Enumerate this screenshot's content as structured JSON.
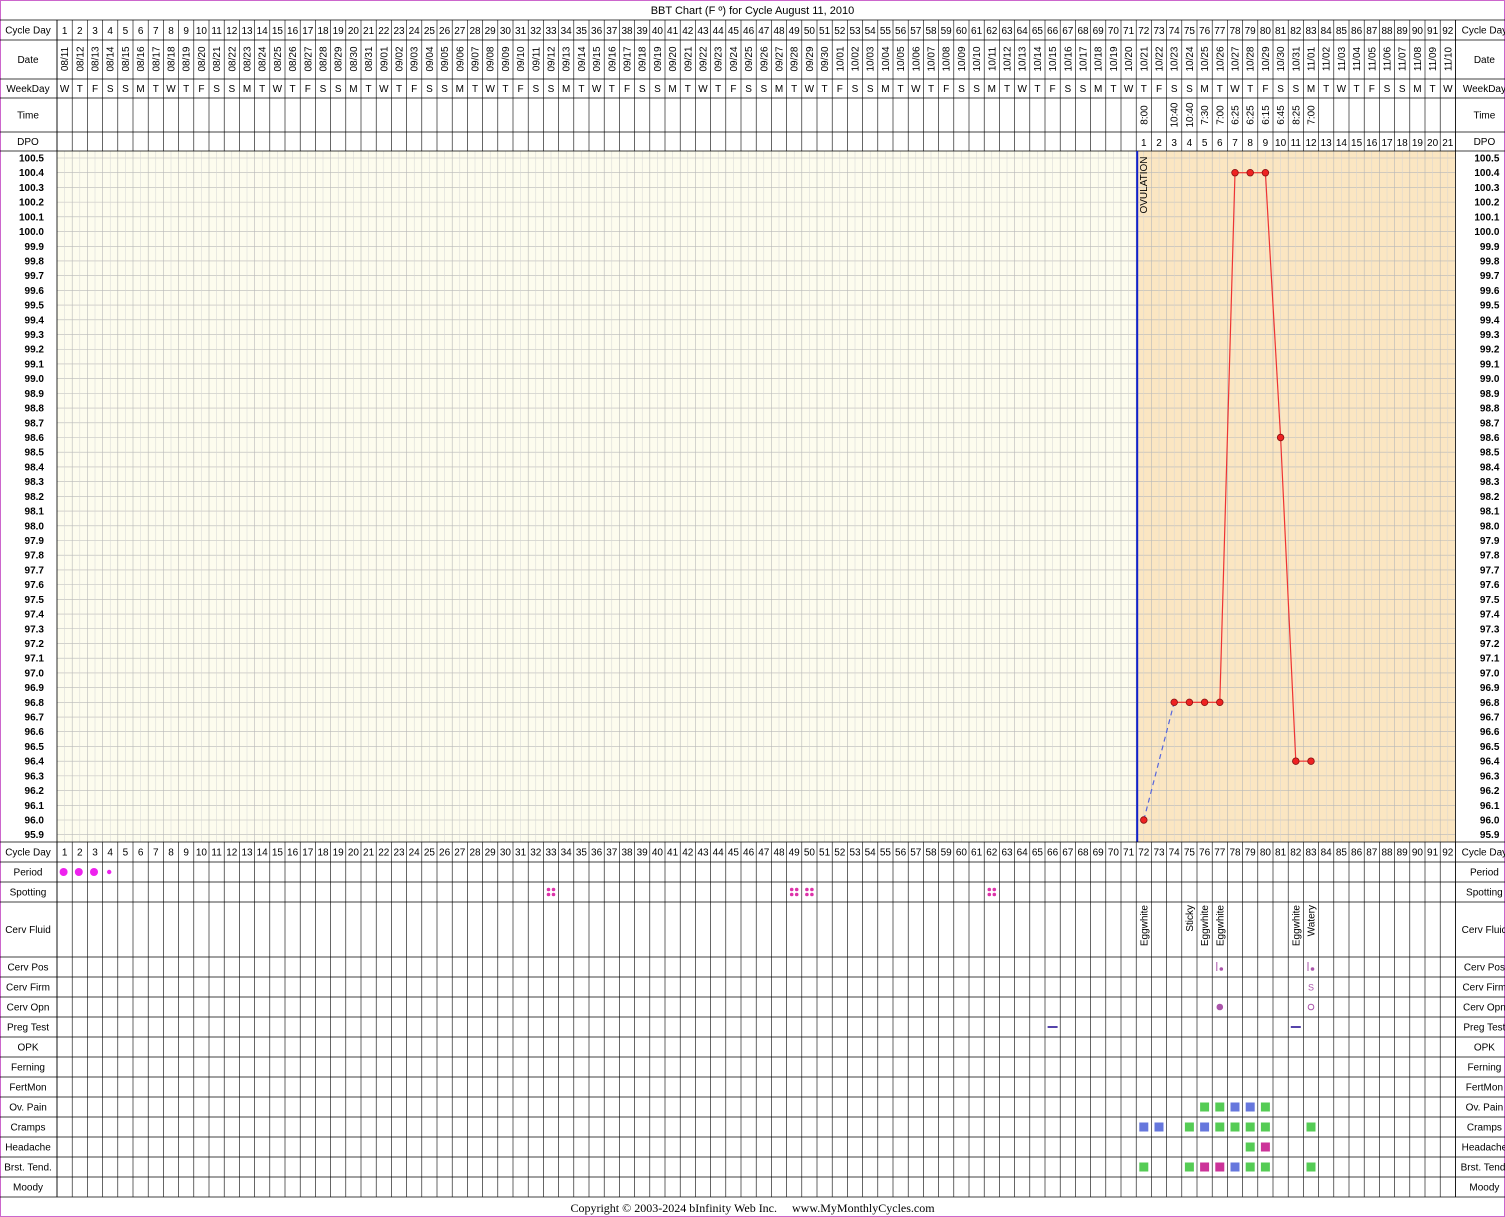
{
  "chart_data": {
    "type": "line",
    "title": "BBT Chart (F º) for Cycle August 11, 2010",
    "copyright": "Copyright © 2003-2024 bInfinity Web Inc.     www.MyMonthlyCycles.com",
    "num_days": 92,
    "start_date": "2010-08-11",
    "start_weekday": 3,
    "weekday_letters": [
      "S",
      "M",
      "T",
      "W",
      "T",
      "F",
      "S"
    ],
    "ylim": [
      95.9,
      100.5
    ],
    "ystep": 0.1,
    "ovulation_day": 71,
    "ovulation_label": "OVULATION",
    "row_labels": {
      "cycle_day": "Cycle Day",
      "date": "Date",
      "weekday": "WeekDay",
      "time": "Time",
      "dpo": "DPO",
      "period": "Period",
      "spotting": "Spotting",
      "cerv_fluid": "Cerv Fluid",
      "cerv_pos": "Cerv Pos",
      "cerv_firm": "Cerv Firm",
      "cerv_opn": "Cerv Opn",
      "preg_test": "Preg Test",
      "opk": "OPK",
      "ferning": "Ferning",
      "fertmon": "FertMon",
      "ov_pain": "Ov. Pain",
      "cramps": "Cramps",
      "headache": "Headache",
      "brst_tend": "Brst. Tend.",
      "moody": "Moody"
    },
    "times": [
      {
        "day": 72,
        "time": "8:00"
      },
      {
        "day": 74,
        "time": "10:40"
      },
      {
        "day": 75,
        "time": "10:40"
      },
      {
        "day": 76,
        "time": "7:30"
      },
      {
        "day": 77,
        "time": "7:00"
      },
      {
        "day": 78,
        "time": "6:25"
      },
      {
        "day": 79,
        "time": "6:25"
      },
      {
        "day": 80,
        "time": "6:15"
      },
      {
        "day": 81,
        "time": "6:45"
      },
      {
        "day": 82,
        "time": "8:25"
      },
      {
        "day": 83,
        "time": "7:00"
      }
    ],
    "series": [
      {
        "points": [
          {
            "x": 72,
            "y": 96.0
          },
          {
            "x": 74,
            "y": 96.8
          },
          {
            "x": 75,
            "y": 96.8
          },
          {
            "x": 76,
            "y": 96.8
          },
          {
            "x": 77,
            "y": 96.8
          },
          {
            "x": 78,
            "y": 100.4
          },
          {
            "x": 79,
            "y": 100.4
          },
          {
            "x": 80,
            "y": 100.4
          },
          {
            "x": 81,
            "y": 98.6
          },
          {
            "x": 82,
            "y": 96.4
          },
          {
            "x": 83,
            "y": 96.4
          }
        ]
      }
    ],
    "period": [
      {
        "day": 1,
        "size": "large"
      },
      {
        "day": 2,
        "size": "large"
      },
      {
        "day": 3,
        "size": "large"
      },
      {
        "day": 4,
        "size": "small"
      }
    ],
    "spotting_days": [
      33,
      49,
      50,
      62
    ],
    "cerv_fluid": [
      {
        "day": 72,
        "labels": [
          "Eggwhite"
        ]
      },
      {
        "day": 75,
        "labels": [
          "Sticky"
        ]
      },
      {
        "day": 76,
        "labels": [
          "Eggwhite"
        ]
      },
      {
        "day": 77,
        "labels": [
          "Eggwhite"
        ]
      },
      {
        "day": 82,
        "labels": [
          "Eggwhite"
        ]
      },
      {
        "day": 83,
        "labels": [
          "Watery"
        ]
      }
    ],
    "cerv_pos_days": [
      77,
      83
    ],
    "cerv_firm": [
      {
        "day": 83,
        "label": "S"
      }
    ],
    "cerv_opn": [
      {
        "day": 77,
        "style": "filled"
      },
      {
        "day": 83,
        "style": "open"
      }
    ],
    "preg_test_days": [
      66,
      82
    ],
    "ov_pain": [
      {
        "day": 76,
        "color": "#55cc55"
      },
      {
        "day": 77,
        "color": "#55cc55"
      },
      {
        "day": 78,
        "color": "#6677dd"
      },
      {
        "day": 79,
        "color": "#6677dd"
      },
      {
        "day": 80,
        "color": "#55cc55"
      }
    ],
    "cramps": [
      {
        "day": 72,
        "color": "#6677dd"
      },
      {
        "day": 73,
        "color": "#6677dd"
      },
      {
        "day": 75,
        "color": "#55cc55"
      },
      {
        "day": 76,
        "color": "#6677dd"
      },
      {
        "day": 77,
        "color": "#55cc55"
      },
      {
        "day": 78,
        "color": "#55cc55"
      },
      {
        "day": 79,
        "color": "#55cc55"
      },
      {
        "day": 80,
        "color": "#55cc55"
      },
      {
        "day": 83,
        "color": "#55cc55"
      }
    ],
    "headache": [
      {
        "day": 79,
        "color": "#55cc55"
      },
      {
        "day": 80,
        "color": "#cc3399"
      }
    ],
    "brst_tend": [
      {
        "day": 72,
        "color": "#55cc55"
      },
      {
        "day": 75,
        "color": "#55cc55"
      },
      {
        "day": 76,
        "color": "#cc3399"
      },
      {
        "day": 77,
        "color": "#cc3399"
      },
      {
        "day": 78,
        "color": "#6677dd"
      },
      {
        "day": 79,
        "color": "#55cc55"
      },
      {
        "day": 80,
        "color": "#55cc55"
      },
      {
        "day": 83,
        "color": "#55cc55"
      }
    ],
    "colors": {
      "background": "#fdfcee",
      "luteal": "#fbe6c2",
      "grid": "#b8b8b8",
      "line": "#ee3333",
      "point": "#ee2222",
      "ovulation": "#1122cc",
      "period": "#ee22ee",
      "spotting": "#dd33aa",
      "cerv": "#aa55aa",
      "preg_test": "#5544aa",
      "border": "#cc66cc"
    }
  }
}
